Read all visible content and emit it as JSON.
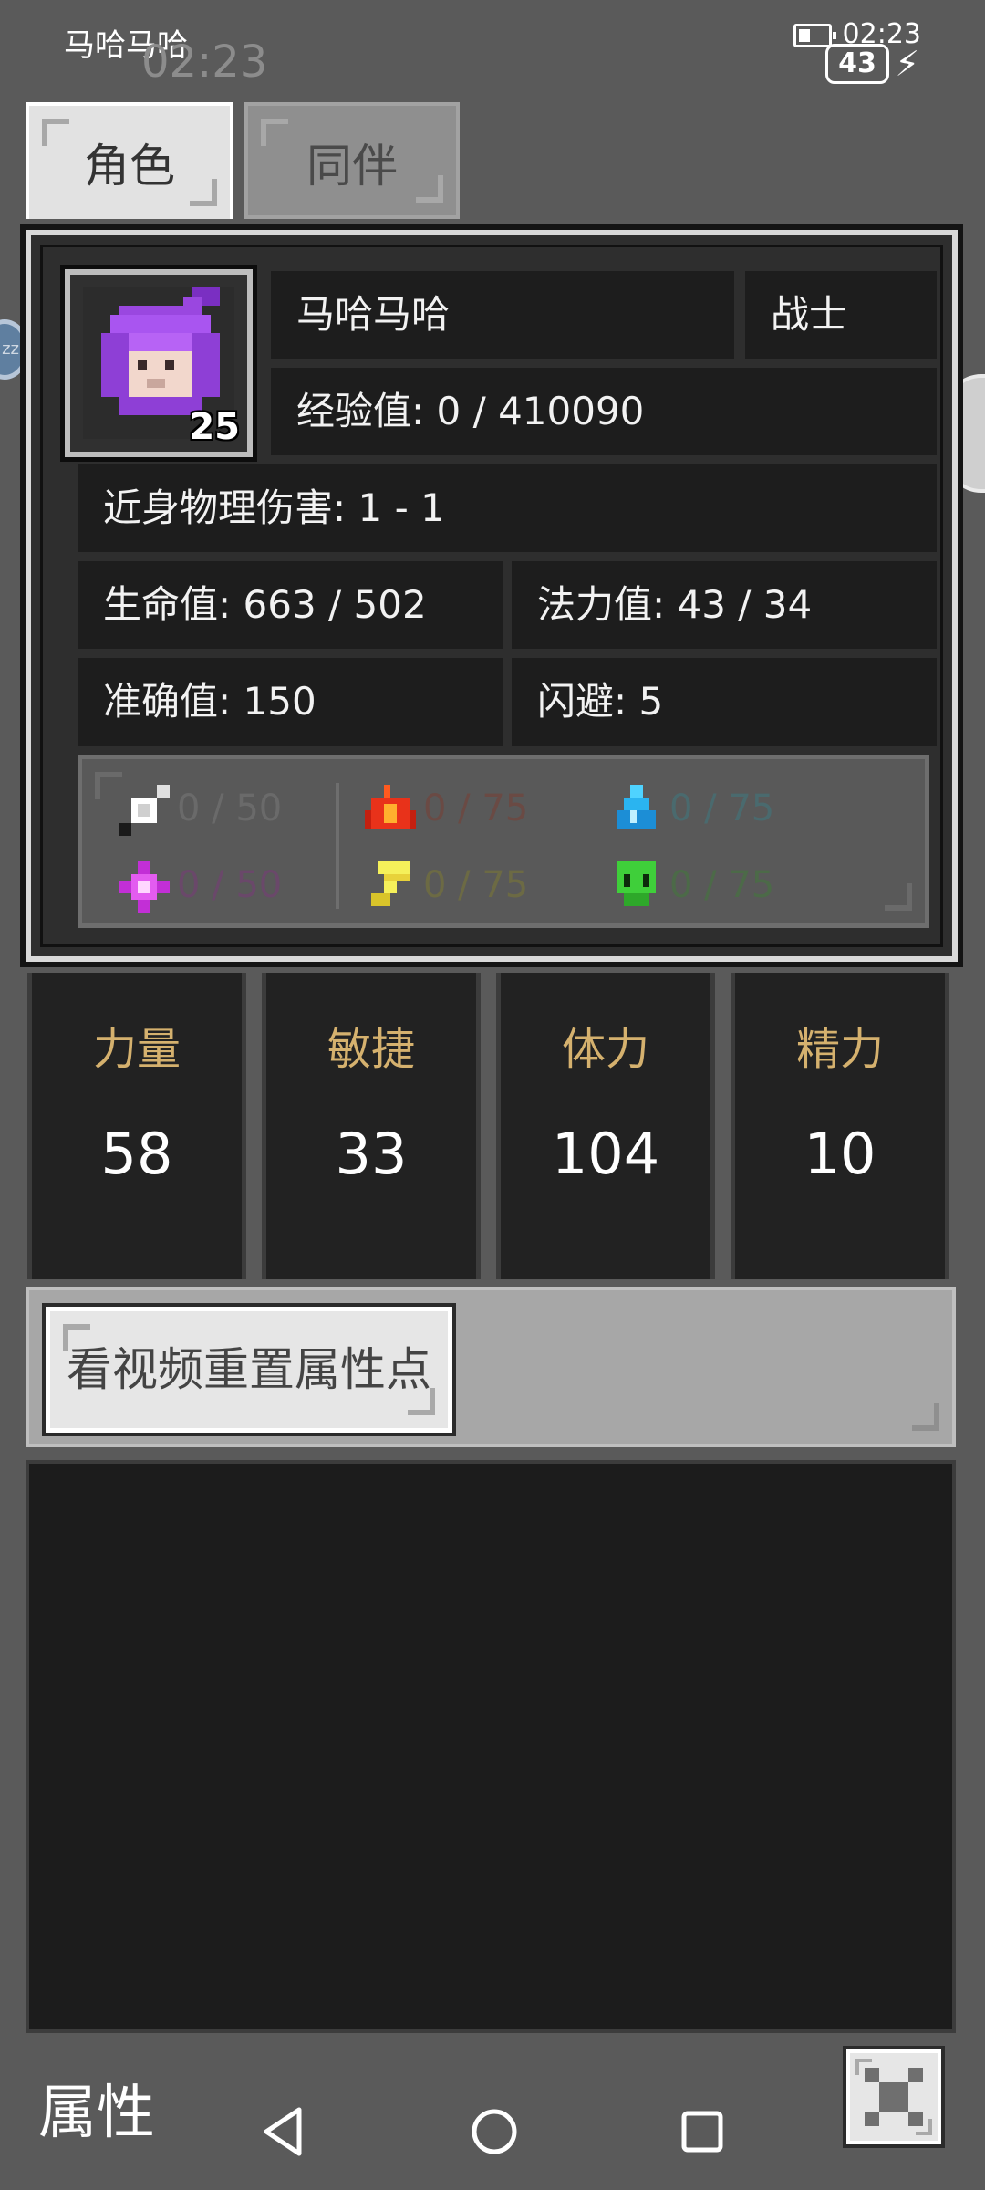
{
  "status_bar": {
    "app_title": "马哈马哈",
    "time_faded": "02:23",
    "time": "02:23",
    "battery_level": "43"
  },
  "tabs": [
    {
      "label": "角色",
      "active": true
    },
    {
      "label": "同伴",
      "active": false
    }
  ],
  "character": {
    "name": "马哈马哈",
    "class": "战士",
    "level": "25",
    "experience": "经验值: 0 / 410090",
    "melee_damage": "近身物理伤害: 1 - 1",
    "hp": "生命值: 663 / 502",
    "mp": "法力值: 43 / 34",
    "accuracy": "准确值: 150",
    "evasion": "闪避: 5"
  },
  "resistances": [
    {
      "icon": "physical-shield-icon",
      "value": "0 / 50",
      "color": "#6a6a6a"
    },
    {
      "icon": "fire-icon",
      "value": "0 / 75",
      "color": "#6a4a44"
    },
    {
      "icon": "water-drop-icon",
      "value": "0 / 75",
      "color": "#4a6a6e"
    },
    {
      "icon": "arcane-star-icon",
      "value": "0 / 50",
      "color": "#6a486a"
    },
    {
      "icon": "lightning-icon",
      "value": "0 / 75",
      "color": "#6c6a44"
    },
    {
      "icon": "poison-skull-icon",
      "value": "0 / 75",
      "color": "#4c6a48"
    }
  ],
  "attributes": [
    {
      "label": "力量",
      "value": "58"
    },
    {
      "label": "敏捷",
      "value": "33"
    },
    {
      "label": "体力",
      "value": "104"
    },
    {
      "label": "精力",
      "value": "10"
    }
  ],
  "reset_button": "看视频重置属性点",
  "footer": {
    "title": "属性"
  },
  "floating": {
    "left_bubble": "zz"
  },
  "colors": {
    "attribute_label": "#d5b16e",
    "panel_bg": "#2e2e2e",
    "cell_bg": "#1d1d1d"
  }
}
